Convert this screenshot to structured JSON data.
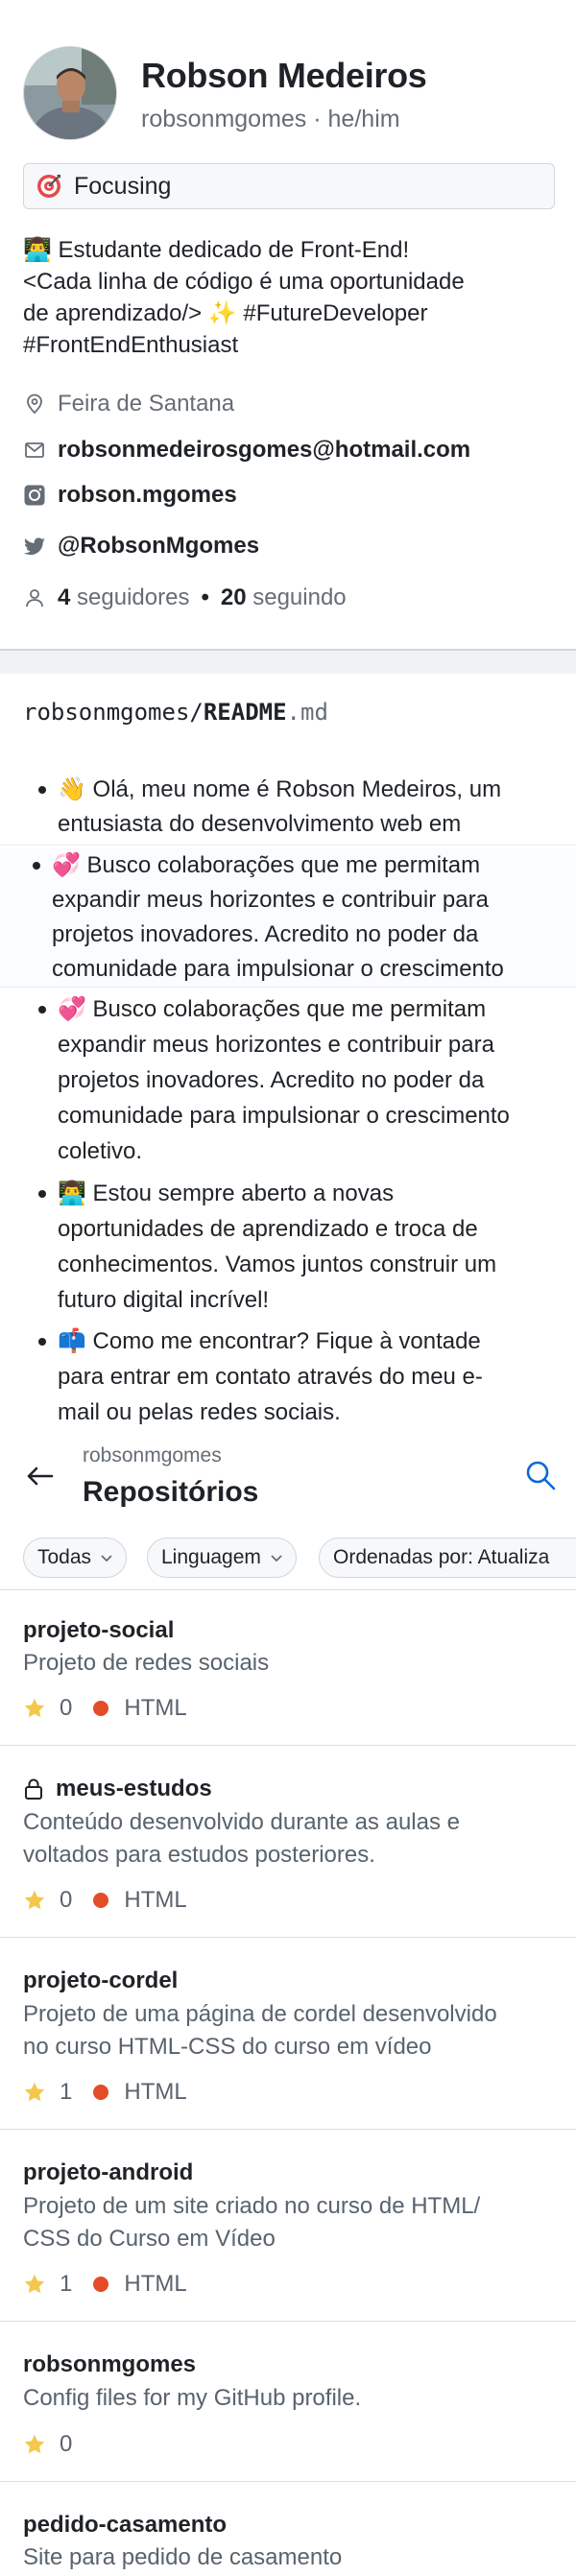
{
  "profile": {
    "name": "Robson Medeiros",
    "username": "robsonmgomes",
    "pronouns": "he/him",
    "status": "Focusing",
    "bio": [
      "👨‍💻 Estudante dedicado de Front-End!",
      "<Cada linha de código é uma oportunidade",
      "de aprendizado/> ✨ #FutureDeveloper",
      "#FrontEndEnthusiast"
    ],
    "location": "Feira de Santana",
    "email": "robsonmedeirosgomes@hotmail.com",
    "instagram": "robson.mgomes",
    "twitter": "@RobsonMgomes",
    "followers_count": "4",
    "followers_label": "seguidores",
    "following_count": "20",
    "following_label": "seguindo"
  },
  "readme": {
    "owner": "robsonmgomes",
    "slash": "/",
    "file": "README",
    "ext": ".md",
    "items": [
      [
        "👋 Olá, meu nome é Robson Medeiros, um",
        "entusiasta do desenvolvimento web em"
      ],
      [
        "💞️ Busco colaborações que me permitam",
        "expandir meus horizontes e contribuir para",
        "projetos inovadores. Acredito no poder da",
        "comunidade para impulsionar o crescimento"
      ],
      [
        "💞️ Busco colaborações que me permitam",
        "expandir meus horizontes e contribuir para",
        "projetos inovadores. Acredito no poder da",
        "comunidade para impulsionar o crescimento",
        "coletivo."
      ],
      [
        "👨‍💻 Estou sempre aberto a novas",
        "oportunidades de aprendizado e troca de",
        "conhecimentos. Vamos juntos construir um",
        "futuro digital incrível!"
      ],
      [
        "📫 Como me encontrar? Fique à vontade",
        "para entrar em contato através do meu e-",
        "mail ou pelas redes sociais."
      ]
    ]
  },
  "repos_header": {
    "owner": "robsonmgomes",
    "title": "Repositórios"
  },
  "filters": [
    "Todas",
    "Linguagem",
    "Ordenadas por: Atualiza"
  ],
  "repos": [
    {
      "name": "projeto-social",
      "desc": [
        "Projeto de redes sociais"
      ],
      "stars": "0",
      "lang": "HTML",
      "private": false
    },
    {
      "name": "meus-estudos",
      "desc": [
        "Conteúdo desenvolvido durante as aulas e",
        "voltados para estudos posteriores."
      ],
      "stars": "0",
      "lang": "HTML",
      "private": true
    },
    {
      "name": "projeto-cordel",
      "desc": [
        "Projeto de uma página de cordel desenvolvido",
        "no curso HTML-CSS do curso em vídeo"
      ],
      "stars": "1",
      "lang": "HTML",
      "private": false
    },
    {
      "name": "projeto-android",
      "desc": [
        "Projeto de um site criado no curso de HTML/",
        "CSS do Curso em Vídeo"
      ],
      "stars": "1",
      "lang": "HTML",
      "private": false
    },
    {
      "name": "robsonmgomes",
      "desc": [
        "Config files for my GitHub profile."
      ],
      "stars": "0",
      "lang": "",
      "private": false
    },
    {
      "name": "pedido-casamento",
      "desc": [
        "Site para pedido de casamento"
      ],
      "stars": "",
      "lang": "",
      "private": false
    }
  ],
  "colors": {
    "html_lang": "#e34c26",
    "star": "#f2c94c",
    "muted": "#656d76",
    "link": "#0969da"
  },
  "icons": {
    "status": "target-emoji",
    "location": "location-pin-icon",
    "email": "mail-icon",
    "instagram": "instagram-icon",
    "twitter": "twitter-icon",
    "people": "person-icon",
    "back": "arrow-left-icon",
    "search": "search-icon",
    "lock": "lock-icon",
    "star": "star-icon"
  }
}
